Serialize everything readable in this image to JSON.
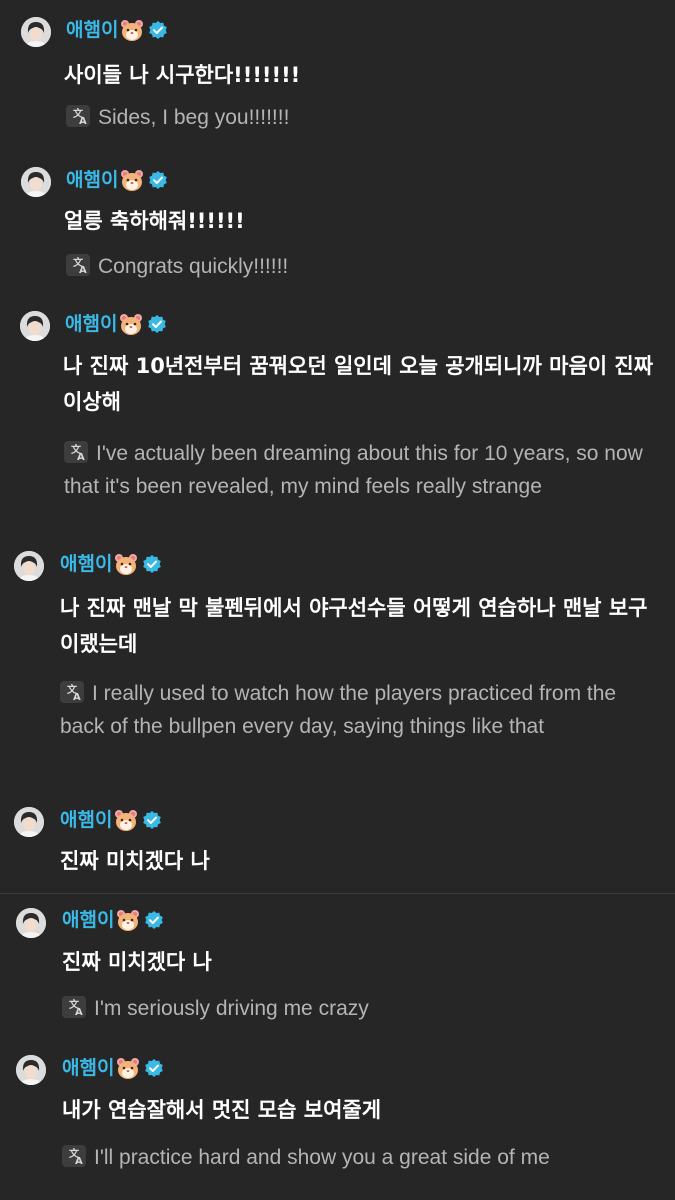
{
  "messages": [
    {
      "author": "애햄이",
      "text": "사이들 나 시구한다!!!!!!!",
      "translation": "Sides, I beg you!!!!!!!"
    },
    {
      "author": "애햄이",
      "text": "얼릉 축하해줘!!!!!!",
      "translation": "Congrats quickly!!!!!!"
    },
    {
      "author": "애햄이",
      "text": "나 진짜 10년전부터 꿈꿔오던 일인데 오늘 공개되니까 마음이 진짜 이상해",
      "translation": "I've actually been dreaming about this for 10 years, so now that it's been revealed, my mind feels really strange"
    },
    {
      "author": "애햄이",
      "text": "나 진짜 맨날 막 불펜뒤에서 야구선수들 어떻게 연습하나 맨날 보구 이랬는데",
      "translation": "I really used to watch how the players practiced from the back of the bullpen every day, saying things like that"
    },
    {
      "author": "애햄이",
      "text": "진짜 미치겠다 나",
      "translation": ""
    },
    {
      "author": "애햄이",
      "text": "진짜 미치겠다 나",
      "translation": "I'm seriously driving me crazy"
    },
    {
      "author": "애햄이",
      "text": "내가 연습잘해서 멋진 모습 보여줄게",
      "translation": "I'll practice hard and show you a great side of me"
    }
  ],
  "colors": {
    "background": "#262626",
    "name": "#3ab8e6",
    "verified": "#3ab8e6",
    "message_text": "#ffffff",
    "translation_text": "#b4b4b4"
  },
  "icons": {
    "avatar": "profile-photo",
    "emoji": "hamster-face",
    "badge": "verified-check",
    "translate": "translate-icon"
  }
}
